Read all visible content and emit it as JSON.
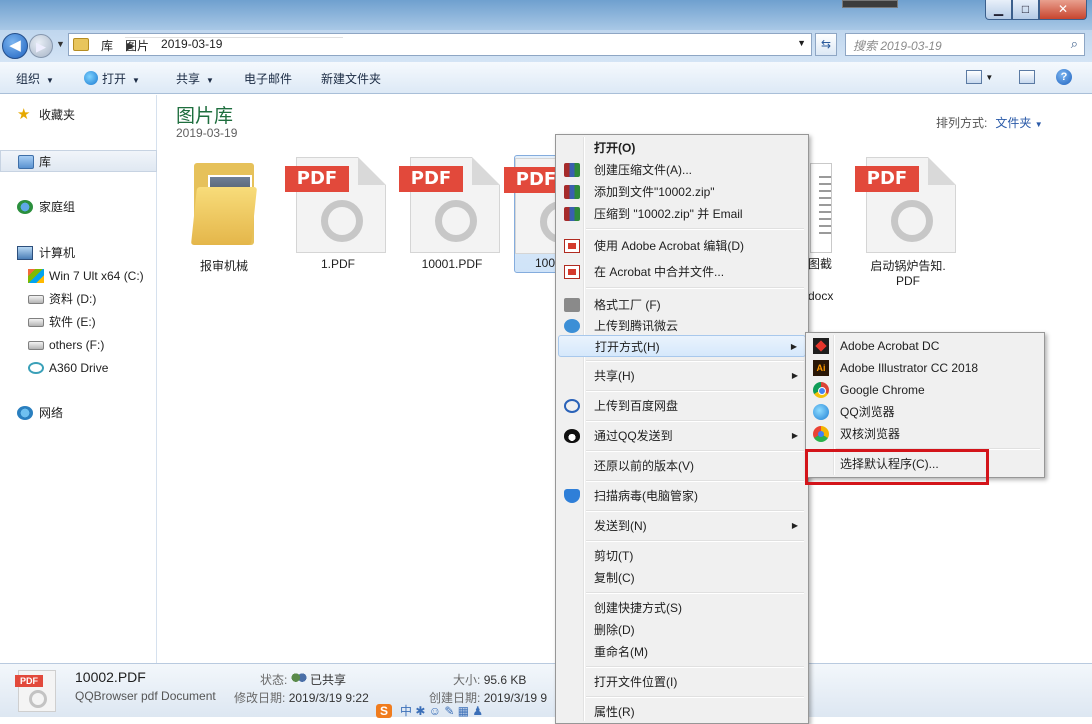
{
  "window": {
    "title": "",
    "controls": {
      "minimize": "▁",
      "maximize": "□",
      "close": "✕"
    }
  },
  "nav": {
    "back_icon": "back-arrow",
    "forward_icon": "forward-arrow",
    "breadcrumbs": [
      "库",
      "图片",
      "2019-03-19"
    ],
    "search_placeholder": "搜索 2019-03-19"
  },
  "toolbar": {
    "organize": "组织",
    "open": "打开",
    "share": "共享",
    "email": "电子邮件",
    "new_folder": "新建文件夹"
  },
  "sidebar": {
    "favorites": "收藏夹",
    "libraries": "库",
    "homegroup": "家庭组",
    "computer": "计算机",
    "drives": [
      "Win 7 Ult x64 (C:)",
      "资料 (D:)",
      "软件 (E:)",
      "others (F:)",
      "A360 Drive"
    ],
    "network": "网络"
  },
  "content": {
    "library_title": "图片库",
    "library_sub": "2019-03-19",
    "arrange_label": "排列方式:",
    "arrange_value": "文件夹",
    "files": [
      {
        "name": "报审机械",
        "type": "folder"
      },
      {
        "name": "1.PDF",
        "type": "pdf"
      },
      {
        "name": "10001.PDF",
        "type": "pdf"
      },
      {
        "name": "100",
        "type": "pdf"
      },
      {
        "name": "图截",
        "type": "docx"
      },
      {
        "name": "docx",
        "type": "docx"
      },
      {
        "name": "启动锅炉告知.",
        "type": "pdf"
      },
      {
        "name": "PDF",
        "type": "pdf"
      }
    ],
    "pdf_badge": "PDF"
  },
  "details": {
    "filename": "10002.PDF",
    "filetype": "QQBrowser pdf Document",
    "status_label": "状态:",
    "status_value": "已共享",
    "modified_label": "修改日期:",
    "modified_value": "2019/3/19 9:22",
    "size_label": "大小:",
    "size_value": "95.6 KB",
    "created_label": "创建日期:",
    "created_value": "2019/3/19 9",
    "badge": "PDF"
  },
  "ime": {
    "s": "S",
    "zh": "中"
  },
  "context_menu": {
    "items": [
      {
        "label": "打开(O)",
        "bold": true
      },
      {
        "label": "创建压缩文件(A)..."
      },
      {
        "label": "添加到文件\"10002.zip\""
      },
      {
        "label": "压缩到 \"10002.zip\" 并 Email"
      },
      {
        "label": "使用 Adobe Acrobat 编辑(D)"
      },
      {
        "label": "在 Acrobat 中合并文件..."
      },
      {
        "label": "格式工厂 (F)"
      },
      {
        "label": "上传到腾讯微云"
      },
      {
        "label": "打开方式(H)"
      },
      {
        "label": "共享(H)"
      },
      {
        "label": "上传到百度网盘"
      },
      {
        "label": "通过QQ发送到"
      },
      {
        "label": "还原以前的版本(V)"
      },
      {
        "label": "扫描病毒(电脑管家)"
      },
      {
        "label": "发送到(N)"
      },
      {
        "label": "剪切(T)"
      },
      {
        "label": "复制(C)"
      },
      {
        "label": "创建快捷方式(S)"
      },
      {
        "label": "删除(D)"
      },
      {
        "label": "重命名(M)"
      },
      {
        "label": "打开文件位置(I)"
      },
      {
        "label": "属性(R)"
      }
    ],
    "arrow": "▶"
  },
  "submenu": {
    "items": [
      {
        "label": "Adobe Acrobat DC"
      },
      {
        "label": "Adobe Illustrator CC 2018"
      },
      {
        "label": "Google Chrome"
      },
      {
        "label": "QQ浏览器"
      },
      {
        "label": "双核浏览器"
      },
      {
        "label": "选择默认程序(C)..."
      }
    ]
  },
  "colors": {
    "accent": "#2a5aa8",
    "library_title": "#1e6e3e",
    "highlight_box": "#d3141a"
  }
}
